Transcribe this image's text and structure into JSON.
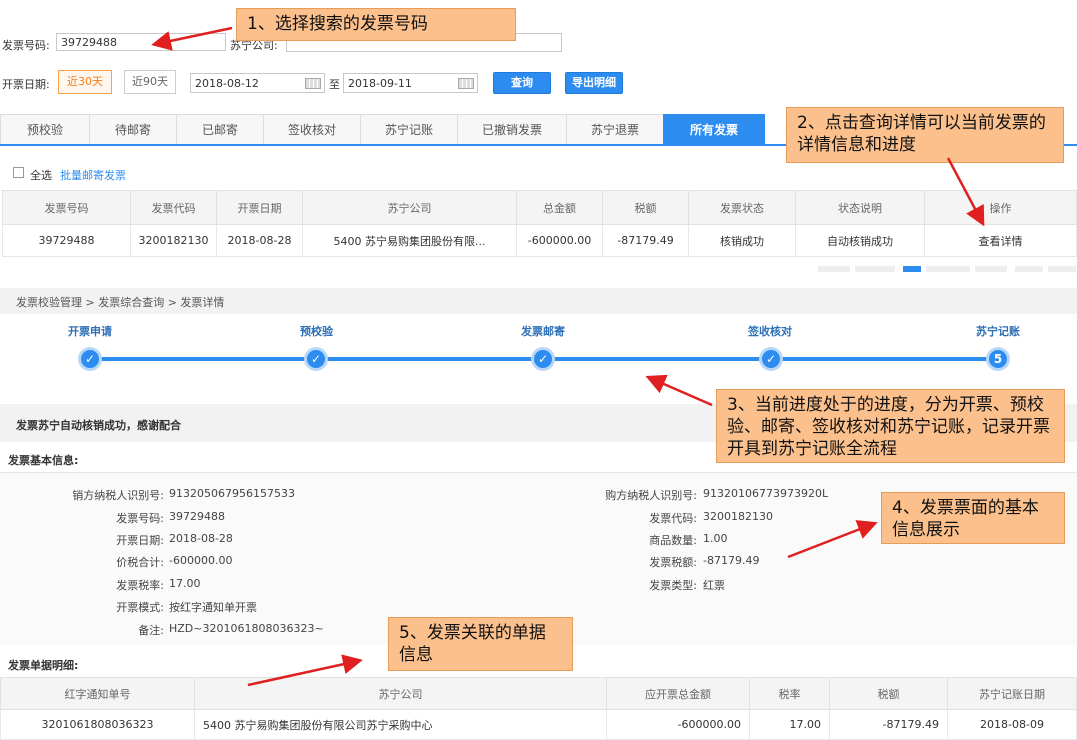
{
  "search": {
    "invoice_no_label": "发票号码:",
    "invoice_no_value": "39729488",
    "company_label": "苏宁公司:",
    "company_value": "",
    "date_label": "开票日期:",
    "range_30": "近30天",
    "range_90": "近90天",
    "date_from": "2018-08-12",
    "date_to_sep": "至",
    "date_to": "2018-09-11",
    "query_button": "查询",
    "export_button": "导出明细"
  },
  "tabs": [
    "预校验",
    "待邮寄",
    "已邮寄",
    "签收核对",
    "苏宁记账",
    "已撤销发票",
    "苏宁退票",
    "所有发票"
  ],
  "list": {
    "select_all": "全选",
    "batch_mail": "批量邮寄发票",
    "columns": [
      "发票号码",
      "发票代码",
      "开票日期",
      "苏宁公司",
      "总金额",
      "税额",
      "发票状态",
      "状态说明",
      "操作"
    ],
    "row": [
      "39729488",
      "3200182130",
      "2018-08-28",
      "5400  苏宁易购集团股份有限...",
      "-600000.00",
      "-87179.49",
      "核销成功",
      "自动核销成功",
      "查看详情"
    ]
  },
  "breadcrumb": "发票校验管理 > 发票综合查询 > 发票详情",
  "progress": {
    "steps": [
      "开票申请",
      "预校验",
      "发票邮寄",
      "签收核对",
      "苏宁记账"
    ],
    "current_number": "5"
  },
  "detail": {
    "status_message": "发票苏宁自动核销成功，感谢配合",
    "basic_info_title": "发票基本信息:",
    "left": [
      {
        "label": "销方纳税人识别号:",
        "value": "913205067956157533"
      },
      {
        "label": "发票号码:",
        "value": "39729488"
      },
      {
        "label": "开票日期:",
        "value": "2018-08-28"
      },
      {
        "label": "价税合计:",
        "value": "-600000.00"
      },
      {
        "label": "发票税率:",
        "value": "17.00"
      },
      {
        "label": "开票模式:",
        "value": "按红字通知单开票"
      },
      {
        "label": "备注:",
        "value": "HZD~3201061808036323~"
      }
    ],
    "right": [
      {
        "label": "购方纳税人识别号:",
        "value": "91320106773973920L"
      },
      {
        "label": "发票代码:",
        "value": "3200182130"
      },
      {
        "label": "商品数量:",
        "value": "1.00"
      },
      {
        "label": "发票税额:",
        "value": "-87179.49"
      },
      {
        "label": "发票类型:",
        "value": "红票"
      }
    ],
    "bill_title": "发票单据明细:",
    "bill_columns": [
      "红字通知单号",
      "苏宁公司",
      "应开票总金额",
      "税率",
      "税额",
      "苏宁记账日期"
    ],
    "bill_row": [
      "3201061808036323",
      "5400 苏宁易购集团股份有限公司苏宁采购中心",
      "-600000.00",
      "17.00",
      "-87179.49",
      "2018-08-09"
    ]
  },
  "annotations": {
    "note1": "1、选择搜索的发票号码",
    "note2": "2、点击查询详情可以当前发票的详情信息和进度",
    "note3": "3、当前进度处于的进度，分为开票、预校验、邮寄、签收核对和苏宁记账，记录开票开具到苏宁记账全流程",
    "note4": "4、发票票面的基本信息展示",
    "note5": "5、发票关联的单据信息"
  },
  "colors": {
    "accent": "#2d8cf0",
    "note_bg": "#fbc08c",
    "arrow": "#e02020"
  }
}
